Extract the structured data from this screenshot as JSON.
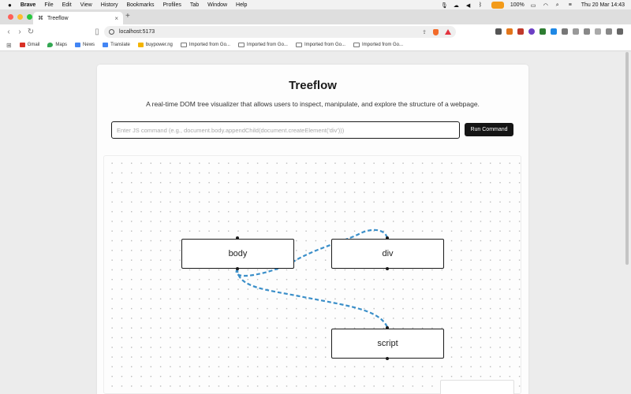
{
  "menubar": {
    "app": "Brave",
    "items": [
      "File",
      "Edit",
      "View",
      "History",
      "Bookmarks",
      "Profiles",
      "Tab",
      "Window",
      "Help"
    ],
    "battery": "100%",
    "clock": "Thu 20 Mar  14:43"
  },
  "tab": {
    "title": "Treeflow",
    "close": "×",
    "new_tab": "+"
  },
  "toolbar": {
    "url": "localhost:5173",
    "back": "‹",
    "forward": "›",
    "reload": "↻"
  },
  "bookmarks": [
    {
      "label": "Gmail",
      "color": "#d93025"
    },
    {
      "label": "Maps",
      "color": "#34a853"
    },
    {
      "label": "News",
      "color": "#4285f4"
    },
    {
      "label": "Translate",
      "color": "#4285f4"
    },
    {
      "label": "buypower.ng",
      "color": "#f4b400"
    },
    {
      "label": "Imported from Go...",
      "folder": true
    },
    {
      "label": "Imported from Go...",
      "folder": true
    },
    {
      "label": "Imported from Go...",
      "folder": true
    },
    {
      "label": "Imported from Go...",
      "folder": true
    }
  ],
  "app": {
    "title": "Treeflow",
    "subtitle": "A real-time DOM tree visualizer that allows users to inspect, manipulate, and explore the structure of a webpage.",
    "command_placeholder": "Enter JS command (e.g., document.body.appendChild(document.createElement('div')))",
    "command_value": "",
    "run_label": "Run Command"
  },
  "tree": {
    "edge_color": "#3b8fc9",
    "nodes": [
      {
        "id": "body",
        "label": "body"
      },
      {
        "id": "div",
        "label": "div"
      },
      {
        "id": "script",
        "label": "script"
      }
    ],
    "edges": [
      {
        "from": "body",
        "to": "div"
      },
      {
        "from": "body",
        "to": "script"
      }
    ]
  }
}
